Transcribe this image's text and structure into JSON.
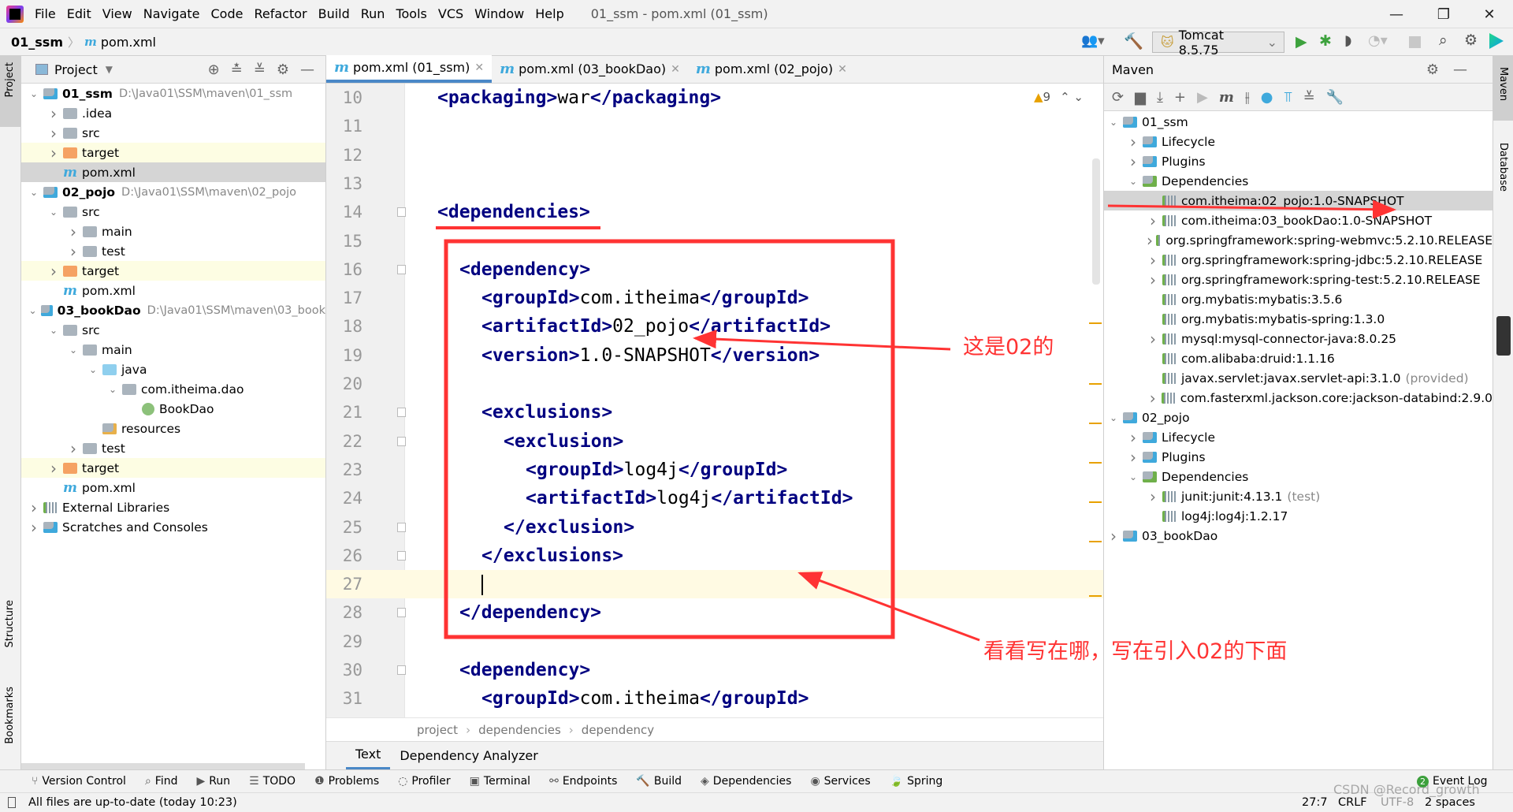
{
  "menubar": {
    "items": [
      "File",
      "Edit",
      "View",
      "Navigate",
      "Code",
      "Refactor",
      "Build",
      "Run",
      "Tools",
      "VCS",
      "Window",
      "Help"
    ],
    "title": "01_ssm - pom.xml (01_ssm)"
  },
  "navbar": {
    "project": "01_ssm",
    "file": "pom.xml",
    "run_config": "Tomcat 8.5.75"
  },
  "left_strip": {
    "project": "Project",
    "structure": "Structure",
    "bookmarks": "Bookmarks"
  },
  "right_strip": {
    "maven": "Maven",
    "database": "Database"
  },
  "project_panel": {
    "title": "Project",
    "tree": [
      {
        "label": "01_ssm",
        "path": "D:\\Java01\\SSM\\maven\\01_ssm",
        "level": 0,
        "arrow": "down",
        "icon": "module",
        "bold": true
      },
      {
        "label": ".idea",
        "level": 1,
        "arrow": "right",
        "icon": "folder"
      },
      {
        "label": "src",
        "level": 1,
        "arrow": "right",
        "icon": "folder"
      },
      {
        "label": "target",
        "level": 1,
        "arrow": "right",
        "icon": "folder-excluded",
        "hl": "yellow"
      },
      {
        "label": "pom.xml",
        "level": 1,
        "arrow": "",
        "icon": "maven",
        "hl": "selected"
      },
      {
        "label": "02_pojo",
        "path": "D:\\Java01\\SSM\\maven\\02_pojo",
        "level": 0,
        "arrow": "down",
        "icon": "module",
        "bold": true
      },
      {
        "label": "src",
        "level": 1,
        "arrow": "down",
        "icon": "folder"
      },
      {
        "label": "main",
        "level": 2,
        "arrow": "right",
        "icon": "folder"
      },
      {
        "label": "test",
        "level": 2,
        "arrow": "right",
        "icon": "folder"
      },
      {
        "label": "target",
        "level": 1,
        "arrow": "right",
        "icon": "folder-excluded",
        "hl": "yellow"
      },
      {
        "label": "pom.xml",
        "level": 1,
        "arrow": "",
        "icon": "maven"
      },
      {
        "label": "03_bookDao",
        "path": "D:\\Java01\\SSM\\maven\\03_book",
        "level": 0,
        "arrow": "down",
        "icon": "module",
        "bold": true
      },
      {
        "label": "src",
        "level": 1,
        "arrow": "down",
        "icon": "folder"
      },
      {
        "label": "main",
        "level": 2,
        "arrow": "down",
        "icon": "folder"
      },
      {
        "label": "java",
        "level": 3,
        "arrow": "down",
        "icon": "folder-source"
      },
      {
        "label": "com.itheima.dao",
        "level": 4,
        "arrow": "down",
        "icon": "package"
      },
      {
        "label": "BookDao",
        "level": 5,
        "arrow": "",
        "icon": "interface"
      },
      {
        "label": "resources",
        "level": 3,
        "arrow": "",
        "icon": "folder-resources"
      },
      {
        "label": "test",
        "level": 2,
        "arrow": "right",
        "icon": "folder"
      },
      {
        "label": "target",
        "level": 1,
        "arrow": "right",
        "icon": "folder-excluded",
        "hl": "yellow"
      },
      {
        "label": "pom.xml",
        "level": 1,
        "arrow": "",
        "icon": "maven"
      },
      {
        "label": "External Libraries",
        "level": 0,
        "arrow": "right",
        "icon": "library"
      },
      {
        "label": "Scratches and Consoles",
        "level": 0,
        "arrow": "right",
        "icon": "scratch"
      }
    ]
  },
  "editor": {
    "tabs": [
      {
        "label": "pom.xml (01_ssm)",
        "active": true
      },
      {
        "label": "pom.xml (03_bookDao)"
      },
      {
        "label": "pom.xml (02_pojo)"
      }
    ],
    "warnings": "9",
    "current_line": 27,
    "lines": [
      {
        "n": 10,
        "i": 0,
        "s": [
          [
            "t",
            "<packaging>"
          ],
          [
            "x",
            "war"
          ],
          [
            "t",
            "</packaging>"
          ]
        ]
      },
      {
        "n": 11,
        "i": 0,
        "s": []
      },
      {
        "n": 12,
        "i": 0,
        "s": []
      },
      {
        "n": 13,
        "i": 0,
        "s": []
      },
      {
        "n": 14,
        "i": 0,
        "s": [
          [
            "t",
            "<dependencies>"
          ]
        ]
      },
      {
        "n": 15,
        "i": 0,
        "s": []
      },
      {
        "n": 16,
        "i": 1,
        "s": [
          [
            "t",
            "<dependency>"
          ]
        ]
      },
      {
        "n": 17,
        "i": 2,
        "s": [
          [
            "t",
            "<groupId>"
          ],
          [
            "x",
            "com.itheima"
          ],
          [
            "t",
            "</groupId>"
          ]
        ]
      },
      {
        "n": 18,
        "i": 2,
        "s": [
          [
            "t",
            "<artifactId>"
          ],
          [
            "x",
            "02_pojo"
          ],
          [
            "t",
            "</artifactId>"
          ]
        ]
      },
      {
        "n": 19,
        "i": 2,
        "s": [
          [
            "t",
            "<version>"
          ],
          [
            "x",
            "1.0-SNAPSHOT"
          ],
          [
            "t",
            "</version>"
          ]
        ]
      },
      {
        "n": 20,
        "i": 0,
        "s": []
      },
      {
        "n": 21,
        "i": 2,
        "s": [
          [
            "t",
            "<exclusions>"
          ]
        ]
      },
      {
        "n": 22,
        "i": 3,
        "s": [
          [
            "t",
            "<exclusion>"
          ]
        ]
      },
      {
        "n": 23,
        "i": 4,
        "s": [
          [
            "t",
            "<groupId>"
          ],
          [
            "x",
            "log4j"
          ],
          [
            "t",
            "</groupId>"
          ]
        ]
      },
      {
        "n": 24,
        "i": 4,
        "s": [
          [
            "t",
            "<artifactId>"
          ],
          [
            "x",
            "log4j"
          ],
          [
            "t",
            "</artifactId>"
          ]
        ]
      },
      {
        "n": 25,
        "i": 3,
        "s": [
          [
            "t",
            "</exclusion>"
          ]
        ]
      },
      {
        "n": 26,
        "i": 2,
        "s": [
          [
            "t",
            "</exclusions>"
          ]
        ]
      },
      {
        "n": 27,
        "i": 2,
        "s": []
      },
      {
        "n": 28,
        "i": 1,
        "s": [
          [
            "t",
            "</dependency>"
          ]
        ]
      },
      {
        "n": 29,
        "i": 0,
        "s": []
      },
      {
        "n": 30,
        "i": 1,
        "s": [
          [
            "t",
            "<dependency>"
          ]
        ]
      },
      {
        "n": 31,
        "i": 2,
        "s": [
          [
            "t",
            "<groupId>"
          ],
          [
            "x",
            "com.itheima"
          ],
          [
            "t",
            "</groupId>"
          ]
        ]
      }
    ],
    "breadcrumb": [
      "project",
      "dependencies",
      "dependency"
    ],
    "bottom_tabs": [
      "Text",
      "Dependency Analyzer"
    ]
  },
  "maven_panel": {
    "title": "Maven",
    "tree": [
      {
        "label": "01_ssm",
        "level": 0,
        "arrow": "down",
        "icon": "maven-module"
      },
      {
        "label": "Lifecycle",
        "level": 1,
        "arrow": "right",
        "icon": "folder-gear"
      },
      {
        "label": "Plugins",
        "level": 1,
        "arrow": "right",
        "icon": "folder-gear"
      },
      {
        "label": "Dependencies",
        "level": 1,
        "arrow": "down",
        "icon": "folder-deps"
      },
      {
        "label": "com.itheima:02_pojo:1.0-SNAPSHOT",
        "level": 2,
        "arrow": "",
        "icon": "library",
        "hl": "selected"
      },
      {
        "label": "com.itheima:03_bookDao:1.0-SNAPSHOT",
        "level": 2,
        "arrow": "right",
        "icon": "library"
      },
      {
        "label": "org.springframework:spring-webmvc:5.2.10.RELEASE",
        "level": 2,
        "arrow": "right",
        "icon": "library"
      },
      {
        "label": "org.springframework:spring-jdbc:5.2.10.RELEASE",
        "level": 2,
        "arrow": "right",
        "icon": "library"
      },
      {
        "label": "org.springframework:spring-test:5.2.10.RELEASE",
        "level": 2,
        "arrow": "right",
        "icon": "library"
      },
      {
        "label": "org.mybatis:mybatis:3.5.6",
        "level": 2,
        "arrow": "",
        "icon": "library"
      },
      {
        "label": "org.mybatis:mybatis-spring:1.3.0",
        "level": 2,
        "arrow": "",
        "icon": "library"
      },
      {
        "label": "mysql:mysql-connector-java:8.0.25",
        "level": 2,
        "arrow": "right",
        "icon": "library"
      },
      {
        "label": "com.alibaba:druid:1.1.16",
        "level": 2,
        "arrow": "",
        "icon": "library"
      },
      {
        "label": "javax.servlet:javax.servlet-api:3.1.0",
        "scope": "(provided)",
        "level": 2,
        "arrow": "",
        "icon": "library"
      },
      {
        "label": "com.fasterxml.jackson.core:jackson-databind:2.9.0",
        "level": 2,
        "arrow": "right",
        "icon": "library"
      },
      {
        "label": "02_pojo",
        "level": 0,
        "arrow": "down",
        "icon": "maven-module"
      },
      {
        "label": "Lifecycle",
        "level": 1,
        "arrow": "right",
        "icon": "folder-gear"
      },
      {
        "label": "Plugins",
        "level": 1,
        "arrow": "right",
        "icon": "folder-gear"
      },
      {
        "label": "Dependencies",
        "level": 1,
        "arrow": "down",
        "icon": "folder-deps"
      },
      {
        "label": "junit:junit:4.13.1",
        "scope": "(test)",
        "level": 2,
        "arrow": "right",
        "icon": "library"
      },
      {
        "label": "log4j:log4j:1.2.17",
        "level": 2,
        "arrow": "",
        "icon": "library"
      },
      {
        "label": "03_bookDao",
        "level": 0,
        "arrow": "right",
        "icon": "maven-module"
      }
    ]
  },
  "annotations": {
    "note1": "这是02的",
    "note2": "看看写在哪，写在引入02的下面",
    "color": "#ff3333"
  },
  "bottom_toolbar": [
    "Version Control",
    "Find",
    "Run",
    "TODO",
    "Problems",
    "Profiler",
    "Terminal",
    "Endpoints",
    "Build",
    "Dependencies",
    "Services",
    "Spring"
  ],
  "event_log": {
    "label": "Event Log",
    "count": "2"
  },
  "status": {
    "message": "All files are up-to-date (today 10:23)",
    "position": "27:7",
    "line_sep": "CRLF",
    "encoding": "UTF-8",
    "indent": "2 spaces",
    "watermark": "CSDN @Record_growth"
  }
}
